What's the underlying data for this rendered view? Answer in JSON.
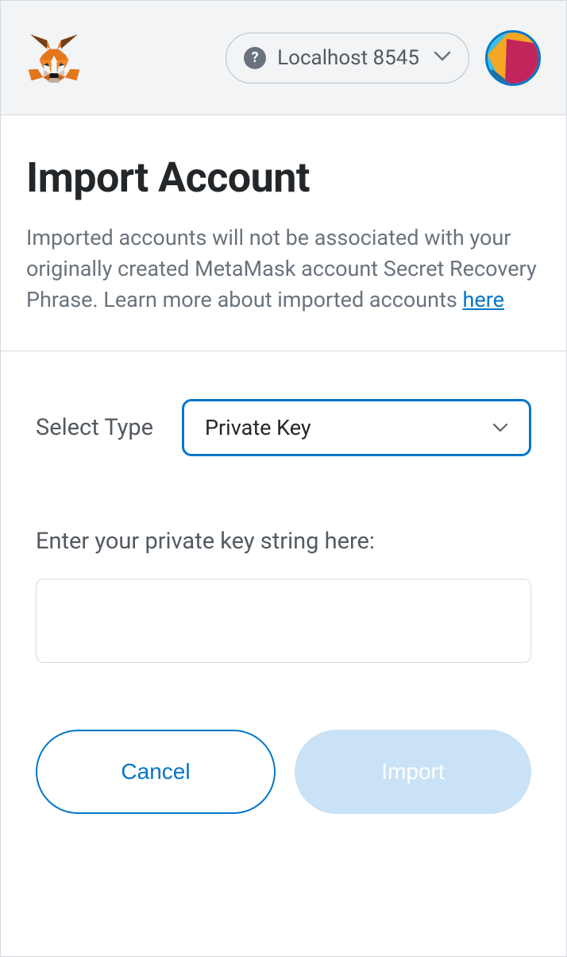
{
  "header": {
    "network_label": "Localhost 8545",
    "network_indicator": "?"
  },
  "page": {
    "title": "Import Account",
    "description_pre": "Imported accounts will not be associated with your originally created MetaMask account Secret Recovery Phrase. Learn more about imported accounts ",
    "description_link": "here"
  },
  "form": {
    "type_label": "Select Type",
    "selected_type": "Private Key",
    "input_label": "Enter your private key string here:",
    "input_value": ""
  },
  "buttons": {
    "cancel": "Cancel",
    "import": "Import"
  }
}
